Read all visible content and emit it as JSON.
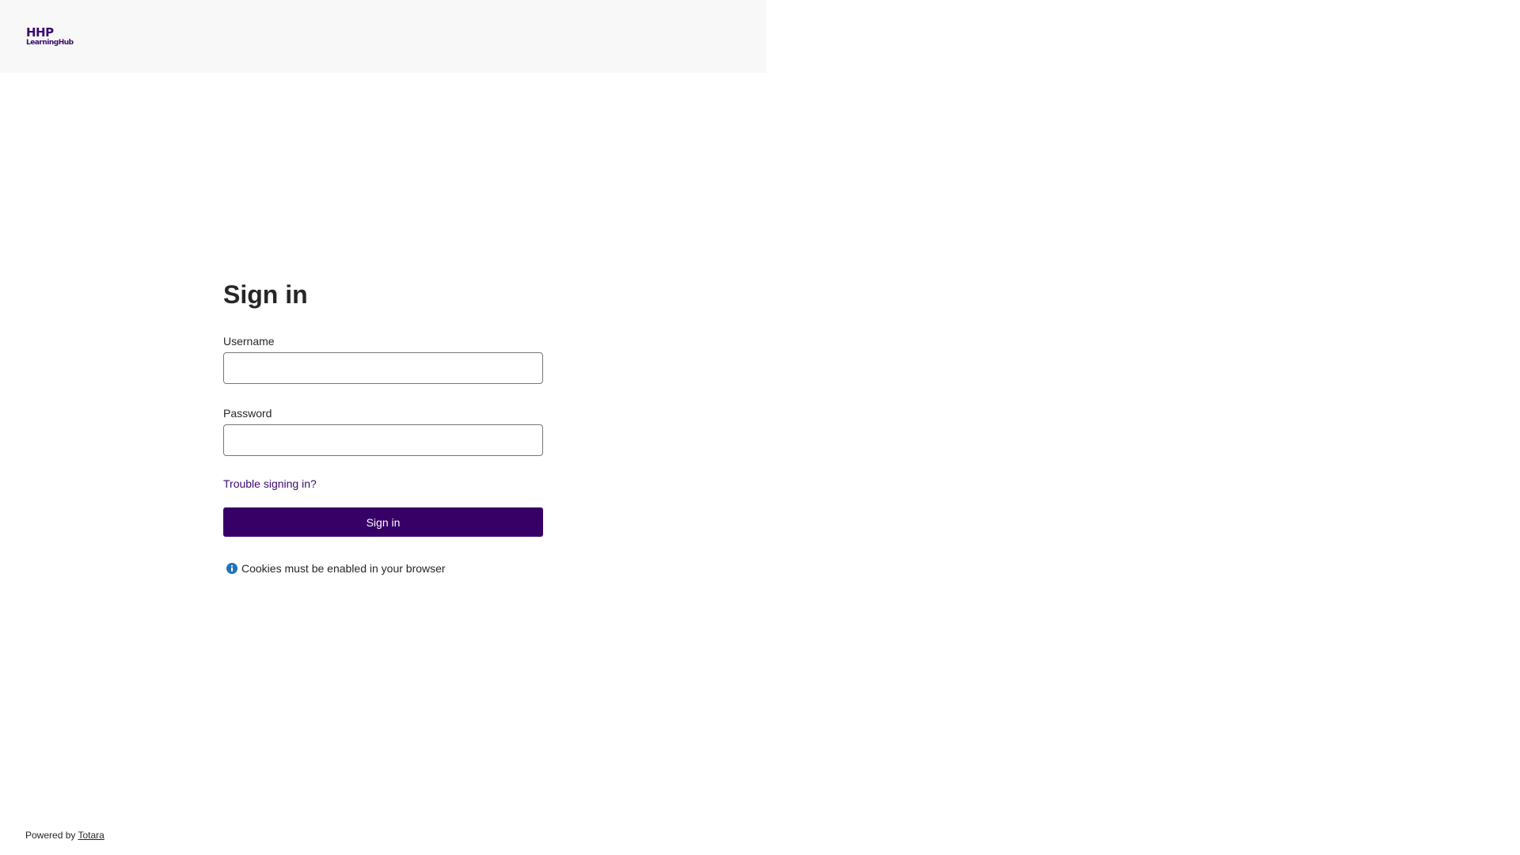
{
  "header": {
    "logo_line1": "HHP",
    "logo_line2": "LearningHub"
  },
  "login": {
    "title": "Sign in",
    "username_label": "Username",
    "username_value": "",
    "password_label": "Password",
    "password_value": "",
    "trouble_link": "Trouble signing in?",
    "signin_button": "Sign in",
    "cookies_notice": "Cookies must be enabled in your browser"
  },
  "footer": {
    "powered_by": "Powered by",
    "vendor_link": "Totara"
  },
  "colors": {
    "brand_purple": "#370066",
    "info_blue": "#1f73b7",
    "header_background": "#f8f8f8"
  },
  "icons": {
    "info": "info-icon"
  }
}
